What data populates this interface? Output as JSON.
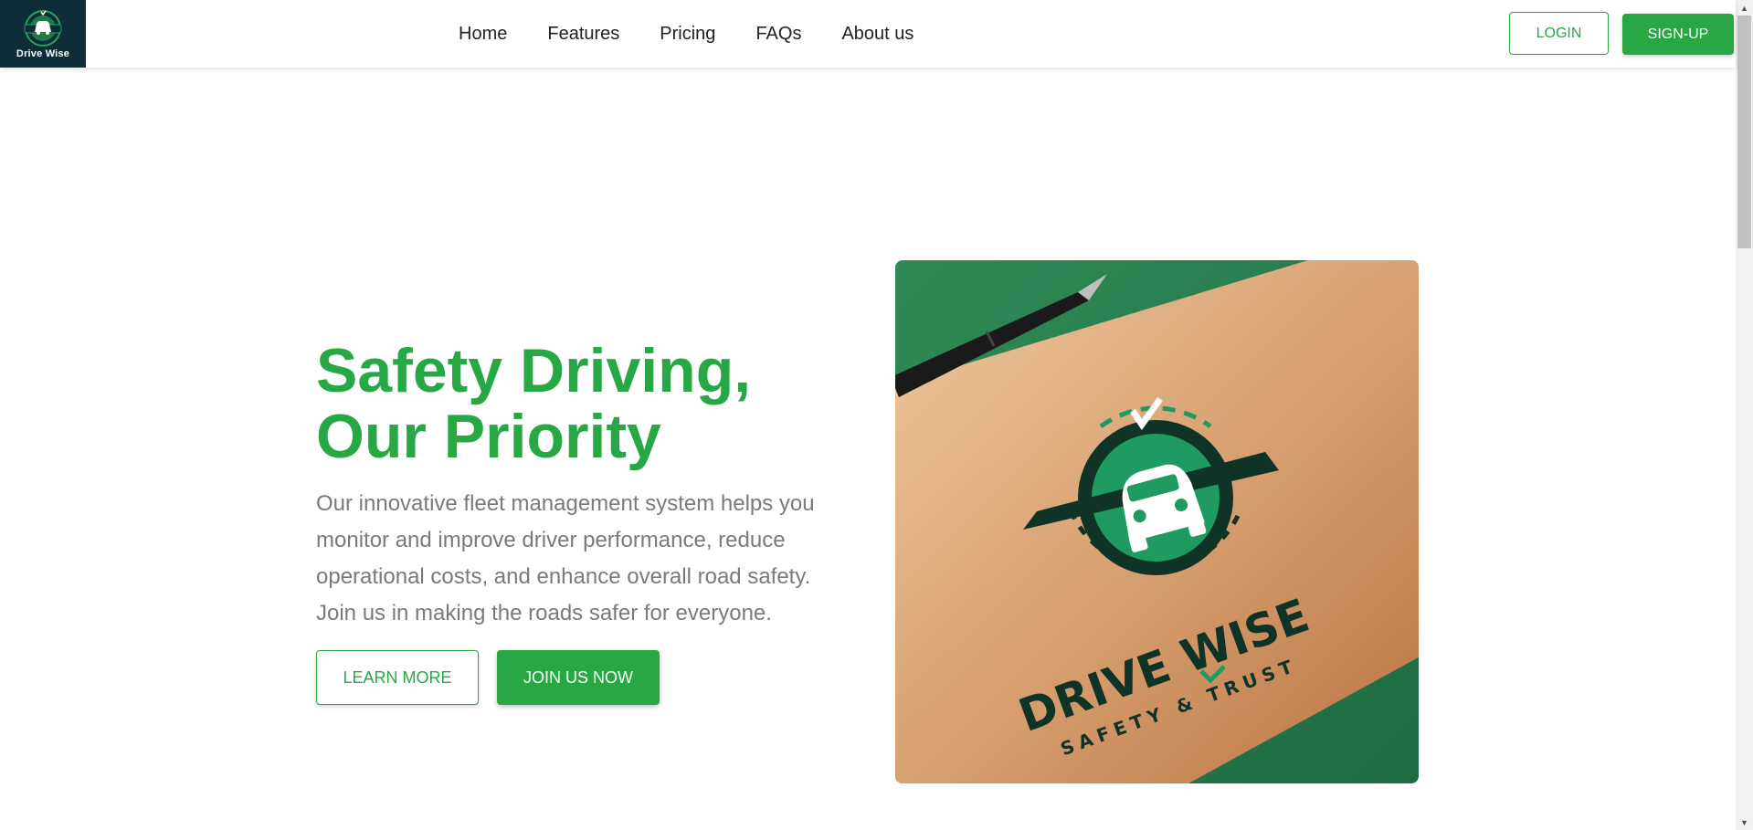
{
  "brand": {
    "name": "Drive Wise",
    "logo_bg": "#0d2e36",
    "accent": "#28a745"
  },
  "nav": {
    "items": [
      {
        "label": "Home"
      },
      {
        "label": "Features"
      },
      {
        "label": "Pricing"
      },
      {
        "label": "FAQs"
      },
      {
        "label": "About us"
      }
    ],
    "login_label": "LOGIN",
    "signup_label": "SIGN-UP"
  },
  "hero": {
    "title_line1": "Safety Driving,",
    "title_line2": "Our Priority",
    "description": "Our innovative fleet management system helps you monitor and improve driver performance, reduce operational costs, and enhance overall road safety. Join us in making the roads safer for everyone.",
    "learn_more_label": "LEARN MORE",
    "join_label": "JOIN US NOW",
    "image": {
      "brand_text": "DRIVE WISE",
      "tagline": "SAFETY & TRUST",
      "icon": "car-badge-icon"
    }
  },
  "scrollbar": {
    "up_icon": "arrow-up-icon",
    "down_icon": "arrow-down-icon"
  }
}
